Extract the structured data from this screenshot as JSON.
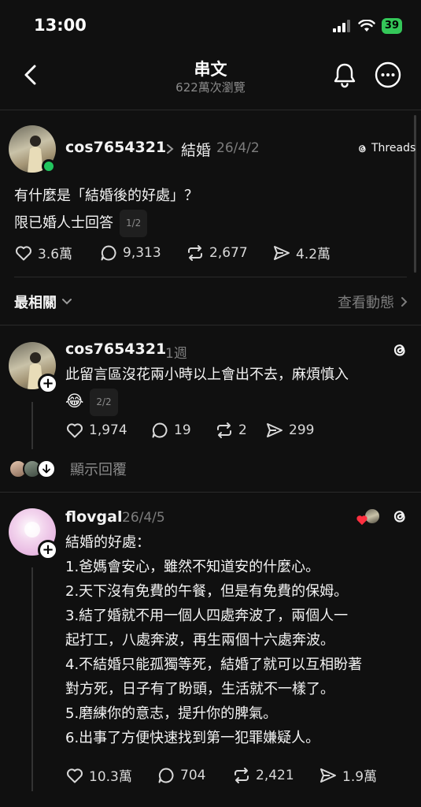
{
  "status": {
    "time": "13:00",
    "battery": "39"
  },
  "nav": {
    "title": "串文",
    "subtitle": "622萬次瀏覽"
  },
  "main_post": {
    "username": "cos7654321",
    "topic": "結婚",
    "date": "26/4/2",
    "threads_label": "Threads",
    "line1": "有什麼是「結婚後的好處」？",
    "line2": "限已婚人士回答",
    "page": "1/2",
    "likes": "3.6萬",
    "comments": "9,313",
    "reposts": "2,677",
    "shares": "4.2萬"
  },
  "sort_bar": {
    "label": "最相關",
    "activity": "查看動態"
  },
  "reply1": {
    "username": "cos7654321",
    "time": "1週",
    "text": "此留言區沒花兩小時以上會出不去，麻煩慎入",
    "emoji": "😂",
    "page": "2/2",
    "likes": "1,974",
    "comments": "19",
    "reposts": "2",
    "shares": "299",
    "show_replies": "顯示回覆"
  },
  "reply2": {
    "username": "flovgal",
    "date": "26/4/5",
    "lines": [
      "結婚的好處：",
      "1.爸媽會安心，雖然不知道安的什麼心。",
      "2.天下沒有免費的午餐，但是有免費的保姆。",
      "3.結了婚就不用一個人四處奔波了，兩個人一",
      "起打工，八處奔波，再生兩個十六處奔波。",
      "4.不結婚只能孤獨等死，結婚了就可以互相盼著",
      "對方死，日子有了盼頭，生活就不一樣了。",
      "5.磨練你的意志，提升你的脾氣。",
      "6.出事了方便快速找到第一犯罪嫌疑人。"
    ],
    "likes": "10.3萬",
    "comments": "704",
    "reposts": "2,421",
    "shares": "1.9萬"
  }
}
